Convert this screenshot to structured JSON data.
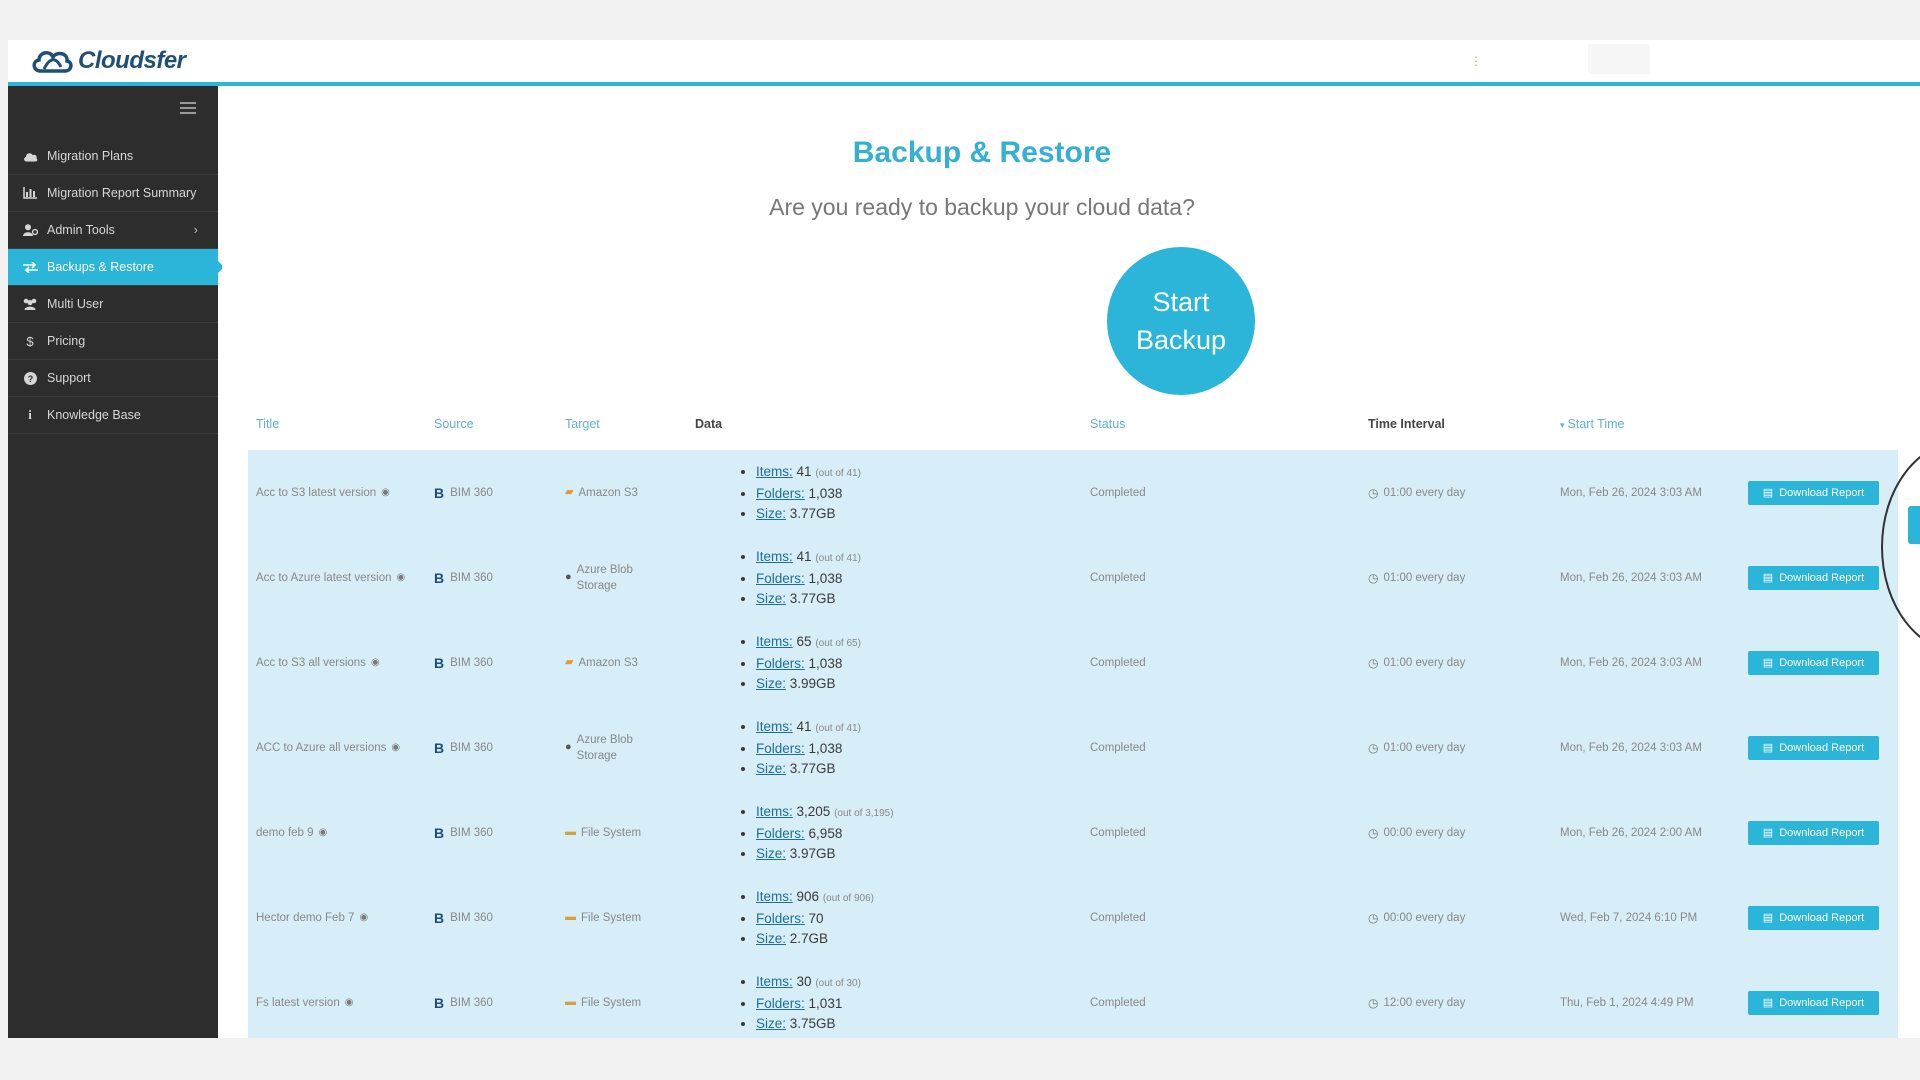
{
  "app": {
    "logo_text": "Cloudsfer"
  },
  "sidebar": {
    "items": [
      {
        "label": "Migration Plans",
        "icon": "cloud-icon"
      },
      {
        "label": "Migration Report Summary",
        "icon": "bar-chart-icon"
      },
      {
        "label": "Admin Tools",
        "icon": "user-gear-icon"
      },
      {
        "label": "Backups & Restore",
        "icon": "swap-icon"
      },
      {
        "label": "Multi User",
        "icon": "users-icon"
      },
      {
        "label": "Pricing",
        "icon": "dollar-icon"
      },
      {
        "label": "Support",
        "icon": "question-icon"
      },
      {
        "label": "Knowledge Base",
        "icon": "info-icon"
      }
    ],
    "active": "Backups & Restore"
  },
  "main": {
    "title": "Backup & Restore",
    "subtitle": "Are you ready to backup your cloud data?",
    "start_line1": "Start",
    "start_line2": "Backup"
  },
  "table": {
    "headers": {
      "title": "Title",
      "source": "Source",
      "target": "Target",
      "data": "Data",
      "status": "Status",
      "interval": "Time Interval",
      "start": "Start Time"
    },
    "data_labels": {
      "items": "Items:",
      "folders": "Folders:",
      "size": "Size:"
    },
    "button_label": "Download Report",
    "rows": [
      {
        "title": "Acc to S3 latest version",
        "source": "BIM 360",
        "target": "Amazon S3",
        "items": "41",
        "items_out": "(out of 41)",
        "folders": "1,038",
        "size": "3.77GB",
        "status": "Completed",
        "interval": "01:00 every day",
        "start": "Mon, Feb 26, 2024 3:03 AM"
      },
      {
        "title": "Acc to Azure latest version",
        "source": "BIM 360",
        "target": "Azure Blob Storage",
        "items": "41",
        "items_out": "(out of 41)",
        "folders": "1,038",
        "size": "3.77GB",
        "status": "Completed",
        "interval": "01:00 every day",
        "start": "Mon, Feb 26, 2024 3:03 AM"
      },
      {
        "title": "Acc to S3 all versions",
        "source": "BIM 360",
        "target": "Amazon S3",
        "items": "65",
        "items_out": "(out of 65)",
        "folders": "1,038",
        "size": "3.99GB",
        "status": "Completed",
        "interval": "01:00 every day",
        "start": "Mon, Feb 26, 2024 3:03 AM"
      },
      {
        "title": "ACC to Azure all versions",
        "source": "BIM 360",
        "target": "Azure Blob Storage",
        "items": "41",
        "items_out": "(out of 41)",
        "folders": "1,038",
        "size": "3.77GB",
        "status": "Completed",
        "interval": "01:00 every day",
        "start": "Mon, Feb 26, 2024 3:03 AM"
      },
      {
        "title": "demo feb 9",
        "source": "BIM 360",
        "target": "File System",
        "items": "3,205",
        "items_out": "(out of 3,195)",
        "folders": "6,958",
        "size": "3.97GB",
        "status": "Completed",
        "interval": "00:00 every day",
        "start": "Mon, Feb 26, 2024 2:00 AM"
      },
      {
        "title": "Hector demo Feb 7",
        "source": "BIM 360",
        "target": "File System",
        "items": "906",
        "items_out": "(out of 906)",
        "folders": "70",
        "size": "2.7GB",
        "status": "Completed",
        "interval": "00:00 every day",
        "start": "Wed, Feb 7, 2024 6:10 PM"
      },
      {
        "title": "Fs latest version",
        "source": "BIM 360",
        "target": "File System",
        "items": "30",
        "items_out": "(out of 30)",
        "folders": "1,031",
        "size": "3.75GB",
        "status": "Completed",
        "interval": "12:00 every day",
        "start": "Thu, Feb 1, 2024 4:49 PM"
      }
    ]
  },
  "colors": {
    "accent": "#2bb5d8",
    "sidebar": "#2d2d2d",
    "row_bg": "#d7edf8",
    "link": "#1d6f98"
  }
}
